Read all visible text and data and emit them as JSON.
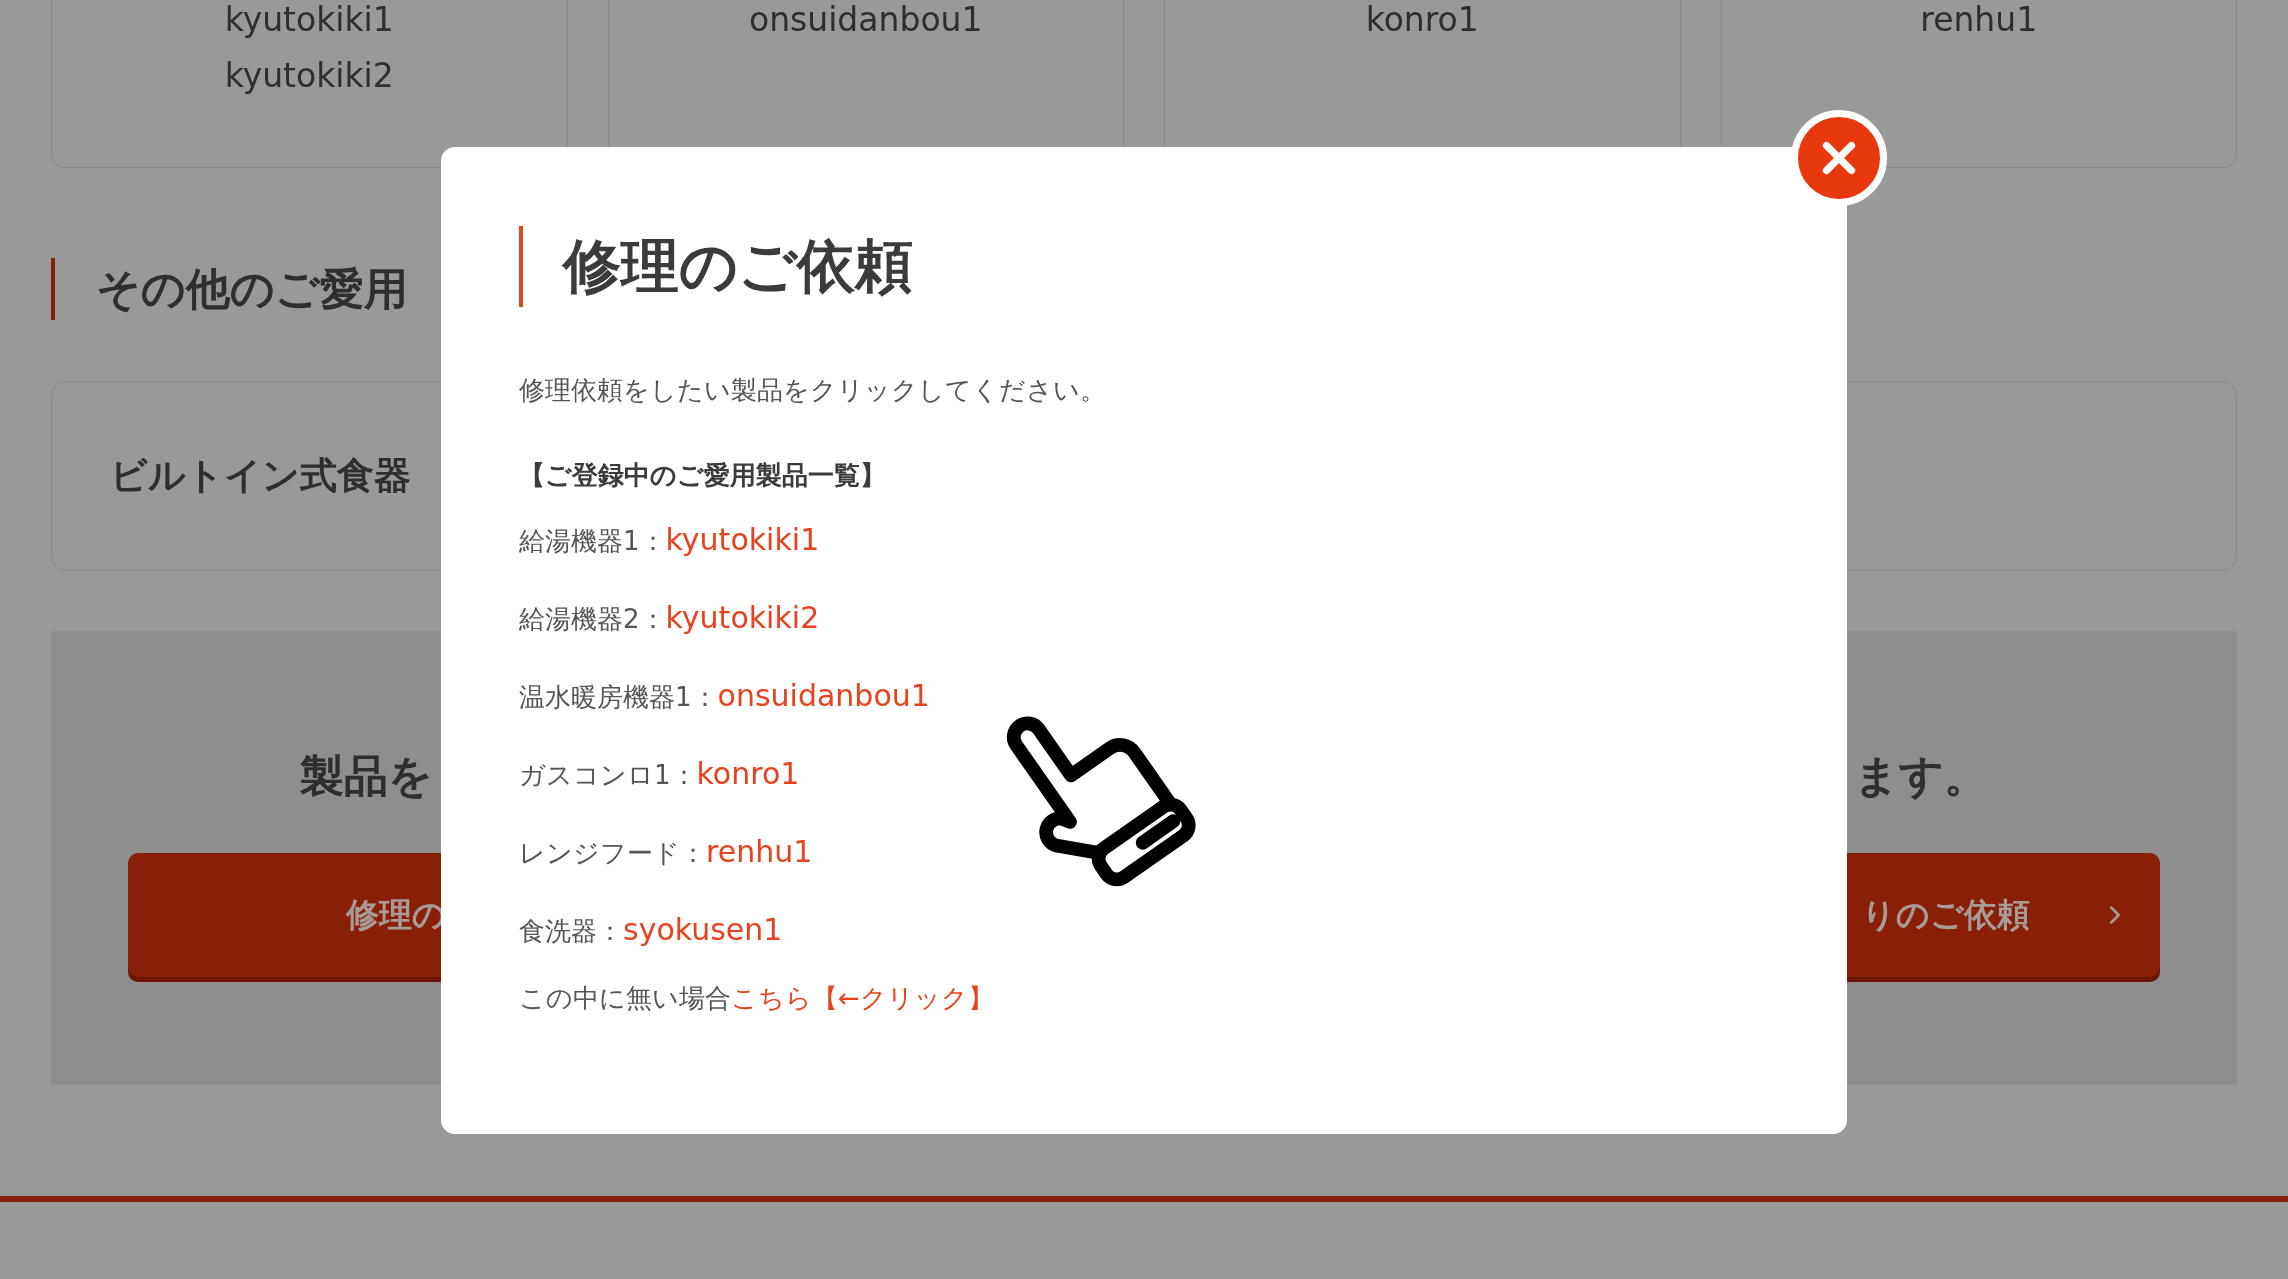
{
  "background": {
    "product_cards": [
      {
        "names": [
          "kyutokiki1",
          "kyutokiki2"
        ]
      },
      {
        "names": [
          "onsuidanbou1"
        ]
      },
      {
        "names": [
          "konro1"
        ]
      },
      {
        "names": [
          "renhu1"
        ]
      }
    ],
    "section_heading": "その他のご愛用",
    "product_card": "ビルトイン式食器",
    "banner": {
      "text_left": "製品を",
      "text_right": "ます。",
      "buttons": [
        {
          "label": "修理の"
        },
        {
          "label": "りのご依頼"
        }
      ]
    }
  },
  "modal": {
    "title": "修理のご依頼",
    "intro": "修理依頼をしたい製品をクリックしてください。",
    "list_heading": "【ご登録中のご愛用製品一覧】",
    "products": [
      {
        "label": "給湯機器1：",
        "link": "kyutokiki1"
      },
      {
        "label": "給湯機器2：",
        "link": "kyutokiki2"
      },
      {
        "label": "温水暖房機器1：",
        "link": "onsuidanbou1"
      },
      {
        "label": "ガスコンロ1：",
        "link": "konro1"
      },
      {
        "label": "レンジフード：",
        "link": "renhu1"
      },
      {
        "label": "食洗器：",
        "link": "syokusen1"
      }
    ],
    "footer": {
      "text": "この中に無い場合",
      "link": "こちら【←クリック】"
    }
  }
}
